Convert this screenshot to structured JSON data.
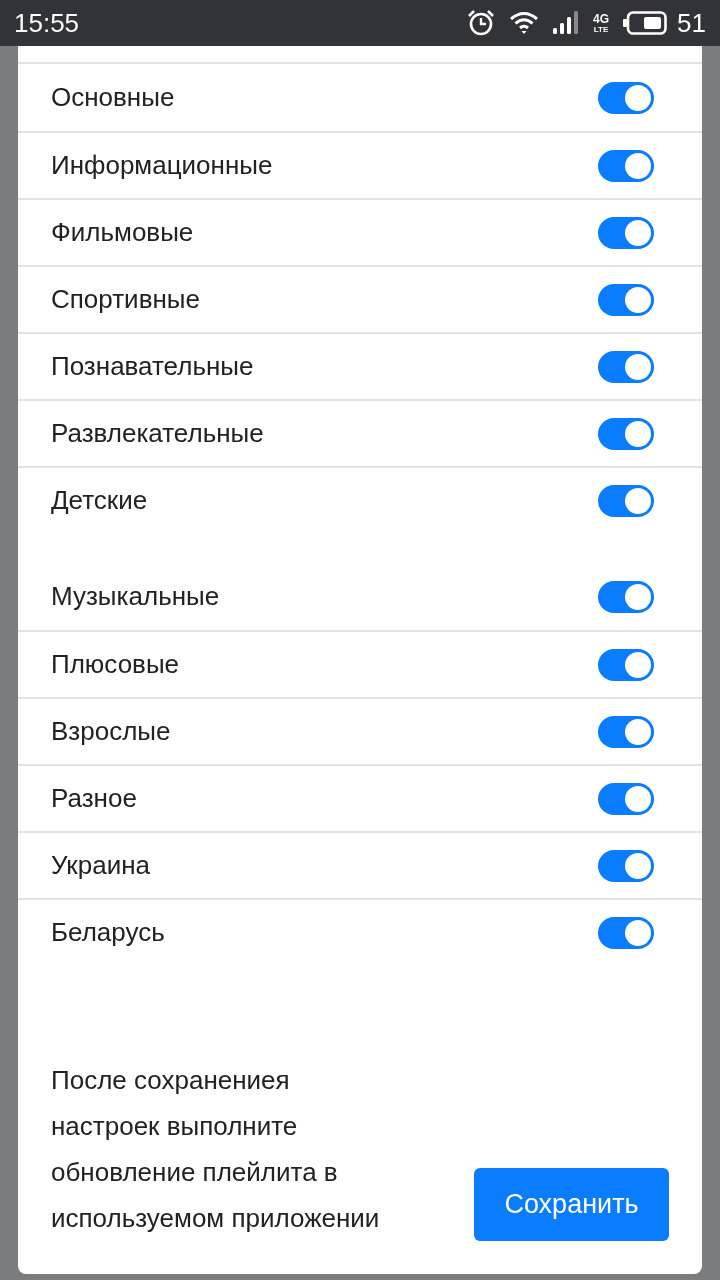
{
  "status_bar": {
    "time": "15:55",
    "network": "4G",
    "network_sub": "LTE",
    "battery": "51"
  },
  "groups": [
    {
      "items": [
        {
          "label": "Основные",
          "on": true
        },
        {
          "label": "Информационные",
          "on": true
        },
        {
          "label": "Фильмовые",
          "on": true
        },
        {
          "label": "Спортивные",
          "on": true
        },
        {
          "label": "Познавательные",
          "on": true
        },
        {
          "label": "Развлекательные",
          "on": true
        },
        {
          "label": "Детские",
          "on": true
        }
      ]
    },
    {
      "items": [
        {
          "label": "Музыкальные",
          "on": true
        },
        {
          "label": "Плюсовые",
          "on": true
        },
        {
          "label": "Взрослые",
          "on": true
        },
        {
          "label": "Разное",
          "on": true
        },
        {
          "label": "Украина",
          "on": true
        },
        {
          "label": "Беларусь",
          "on": true
        }
      ]
    }
  ],
  "footer": {
    "note": "После сохранениея\nнастроек выполните\nобновление плейлита в\nиспользуемом приложении",
    "save_button": "Сохранить"
  }
}
